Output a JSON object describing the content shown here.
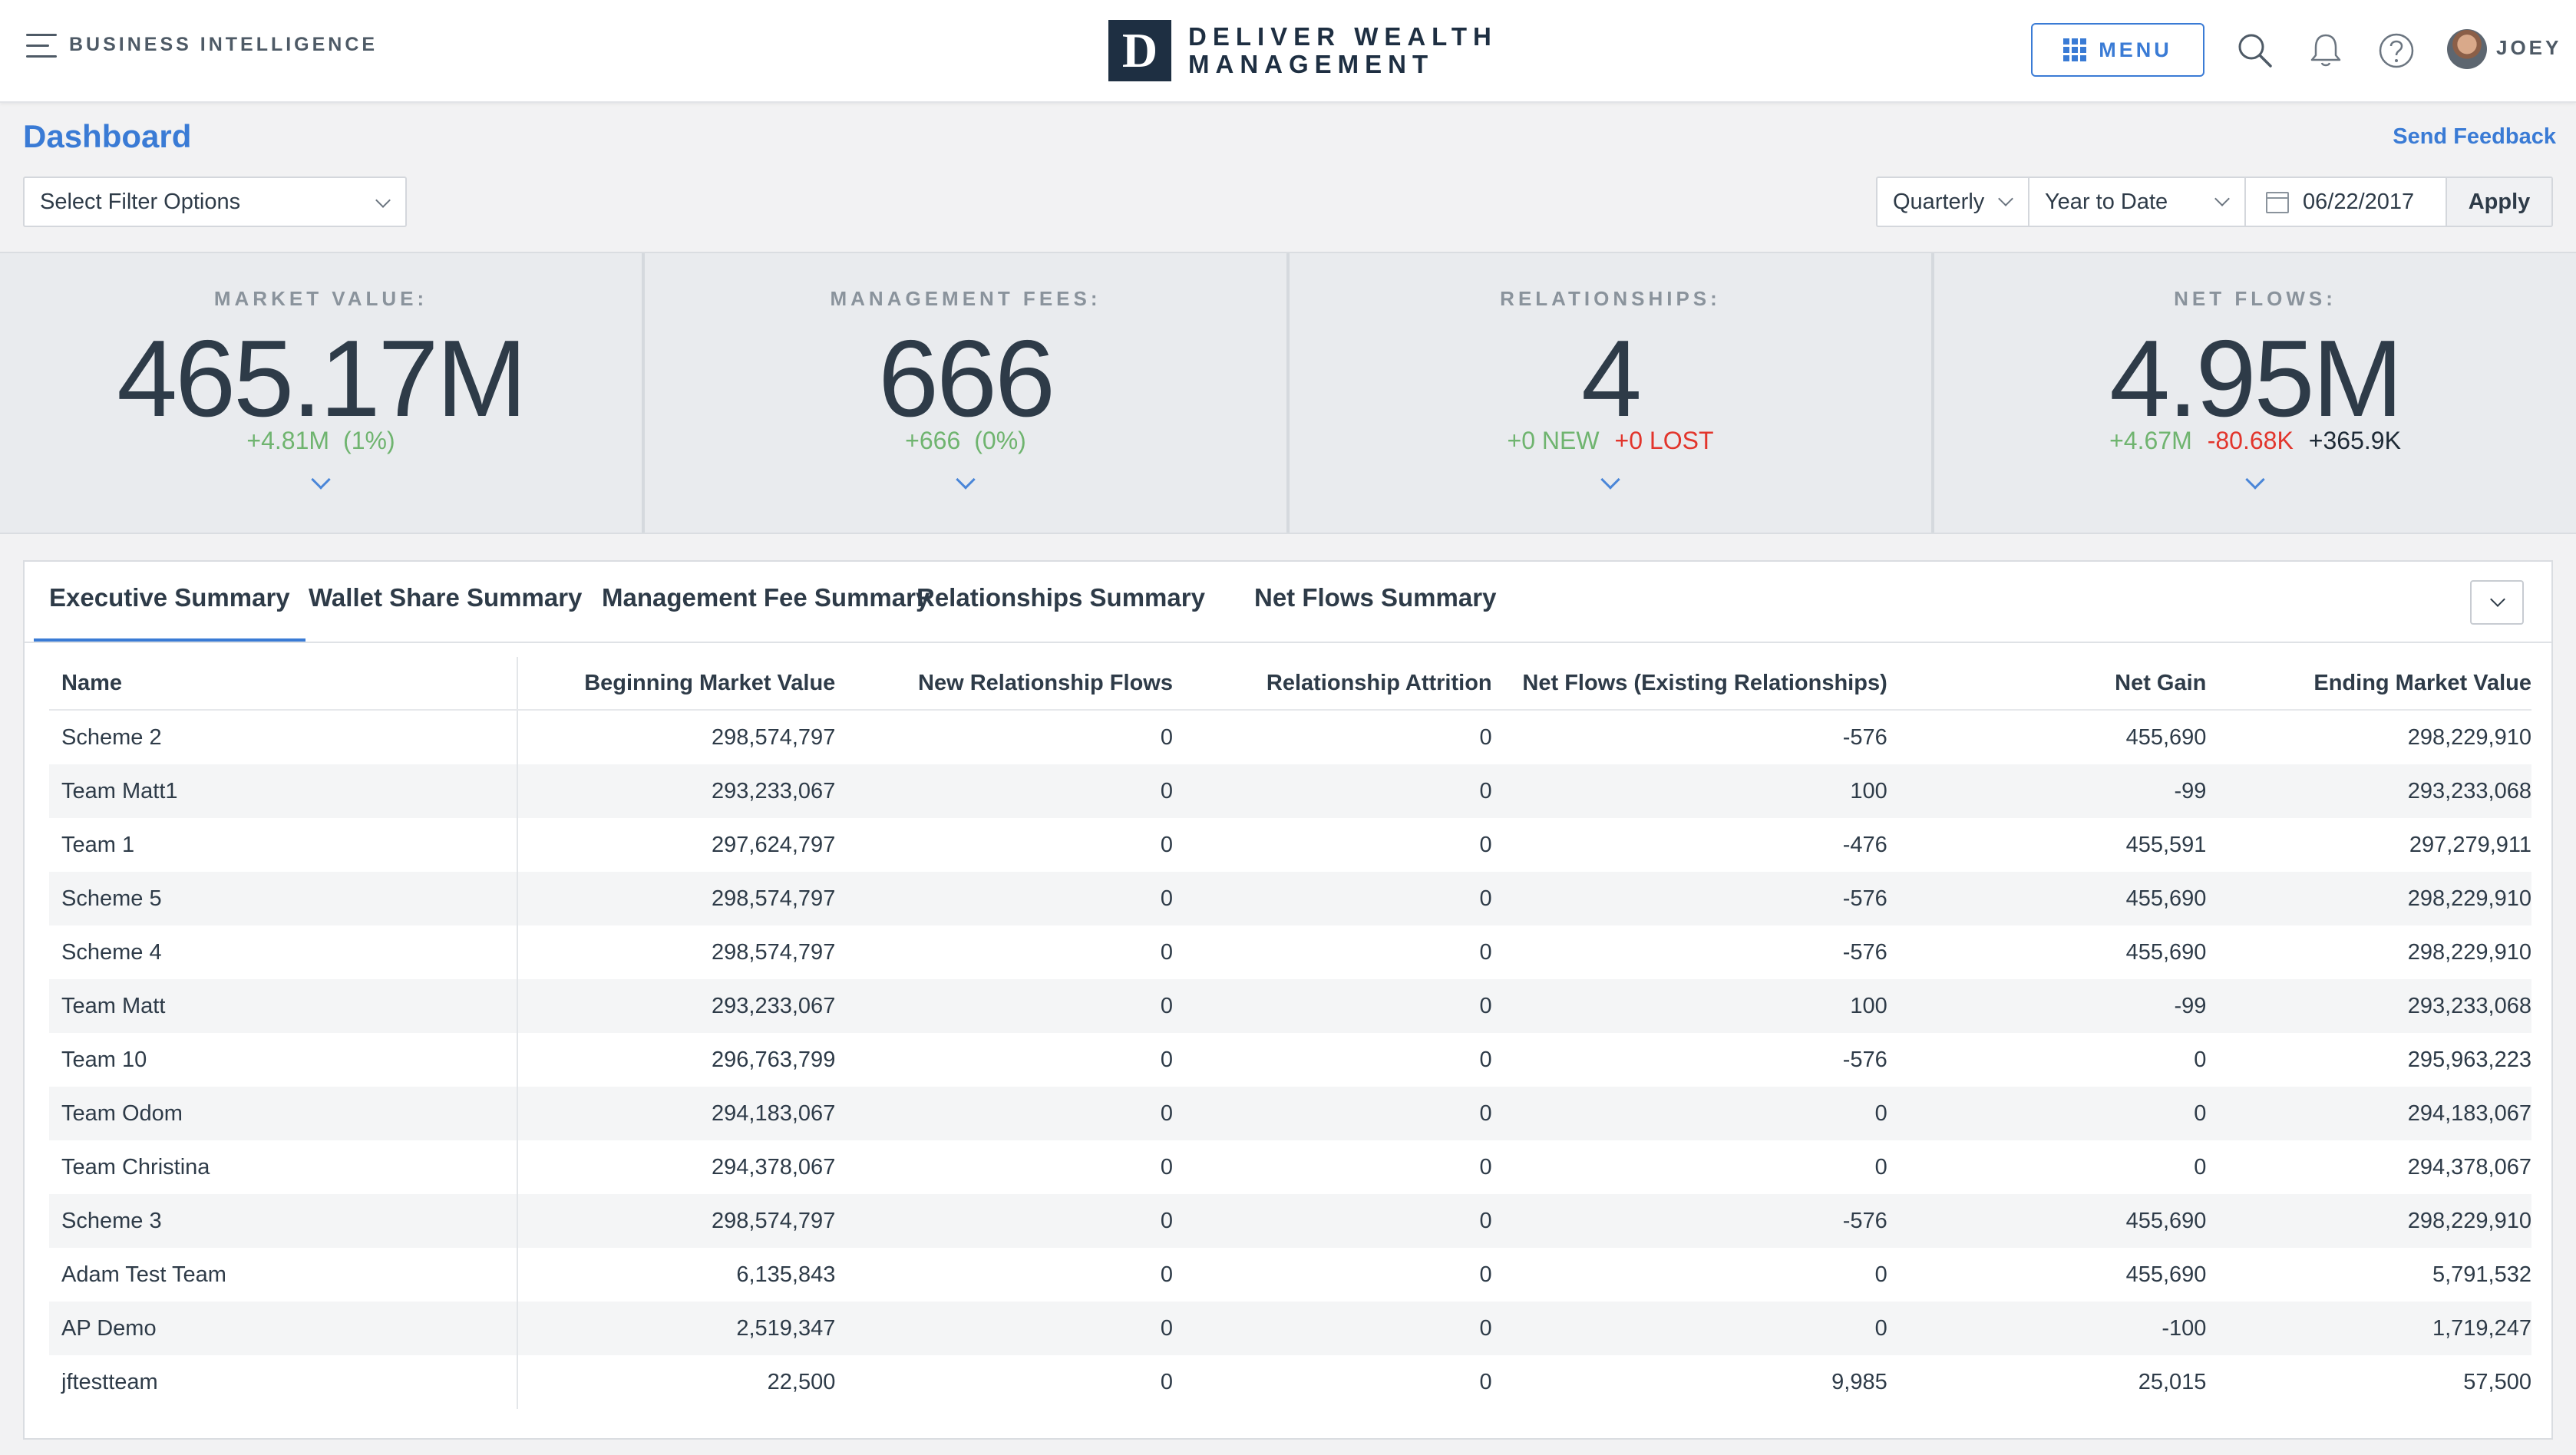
{
  "header": {
    "app_name": "BUSINESS INTELLIGENCE",
    "logo_letter": "D",
    "logo_line1": "DELIVER WEALTH",
    "logo_line2": "MANAGEMENT",
    "menu_label": "MENU",
    "user_name": "JOEY"
  },
  "toolbar": {
    "page_title": "Dashboard",
    "send_feedback": "Send Feedback",
    "filter_select": "Select Filter Options",
    "period": "Quarterly",
    "range": "Year to Date",
    "date": "06/22/2017",
    "apply": "Apply"
  },
  "kpis": [
    {
      "label": "MARKET VALUE:",
      "value": "465.17M",
      "sub": [
        "+4.81M",
        "(1%)"
      ]
    },
    {
      "label": "MANAGEMENT FEES:",
      "value": "666",
      "sub": [
        "+666",
        "(0%)"
      ]
    },
    {
      "label": "RELATIONSHIPS:",
      "value": "4",
      "sub": [
        "+0 NEW",
        "+0 LOST"
      ]
    },
    {
      "label": "NET FLOWS:",
      "value": "4.95M",
      "sub": [
        "+4.67M",
        "-80.68K",
        "+365.9K"
      ]
    }
  ],
  "tabs": [
    "Executive Summary",
    "Wallet Share Summary",
    "Management Fee Summary",
    "Relationships Summary",
    "Net Flows Summary"
  ],
  "table": {
    "columns": [
      "Name",
      "Beginning Market Value",
      "New Relationship Flows",
      "Relationship Attrition",
      "Net Flows (Existing Relationships)",
      "Net Gain",
      "Ending Market Value"
    ],
    "rows": [
      [
        "Scheme 2",
        "298,574,797",
        "0",
        "0",
        "-576",
        "455,690",
        "298,229,910"
      ],
      [
        "Team Matt1",
        "293,233,067",
        "0",
        "0",
        "100",
        "-99",
        "293,233,068"
      ],
      [
        "Team 1",
        "297,624,797",
        "0",
        "0",
        "-476",
        "455,591",
        "297,279,911"
      ],
      [
        "Scheme 5",
        "298,574,797",
        "0",
        "0",
        "-576",
        "455,690",
        "298,229,910"
      ],
      [
        "Scheme 4",
        "298,574,797",
        "0",
        "0",
        "-576",
        "455,690",
        "298,229,910"
      ],
      [
        "Team Matt",
        "293,233,067",
        "0",
        "0",
        "100",
        "-99",
        "293,233,068"
      ],
      [
        "Team 10",
        "296,763,799",
        "0",
        "0",
        "-576",
        "0",
        "295,963,223"
      ],
      [
        "Team Odom",
        "294,183,067",
        "0",
        "0",
        "0",
        "0",
        "294,183,067"
      ],
      [
        "Team Christina",
        "294,378,067",
        "0",
        "0",
        "0",
        "0",
        "294,378,067"
      ],
      [
        "Scheme 3",
        "298,574,797",
        "0",
        "0",
        "-576",
        "455,690",
        "298,229,910"
      ],
      [
        "Adam Test Team",
        "6,135,843",
        "0",
        "0",
        "0",
        "455,690",
        "5,791,532"
      ],
      [
        "AP Demo",
        "2,519,347",
        "0",
        "0",
        "0",
        "-100",
        "1,719,247"
      ],
      [
        "jftestteam",
        "22,500",
        "0",
        "0",
        "9,985",
        "25,015",
        "57,500"
      ]
    ]
  },
  "colors": {
    "accent": "#3a7bd5",
    "positive": "#6fb46f",
    "negative": "#e2352c",
    "brand_navy": "#1e2f42"
  }
}
